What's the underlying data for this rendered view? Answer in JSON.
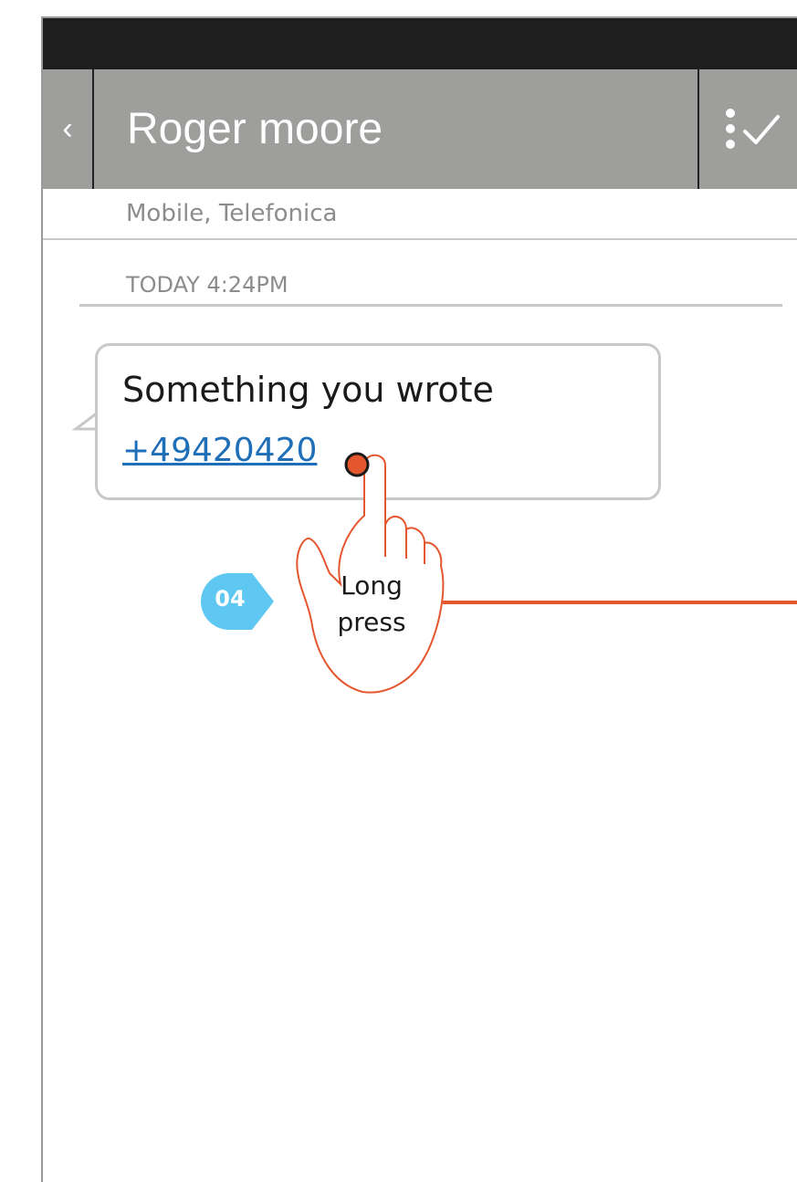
{
  "header": {
    "back_glyph": "‹",
    "title": "Roger moore",
    "actions_icon": "more-select-icon"
  },
  "contact": {
    "subtitle": "Mobile, Telefonica"
  },
  "conversation": {
    "timestamp": "TODAY 4:24PM",
    "message": {
      "text": "Something you wrote",
      "link": "+49420420"
    }
  },
  "annotation": {
    "step": "04",
    "gesture_line1": "Long",
    "gesture_line2": "press",
    "accent_color": "#e4572e",
    "badge_color": "#5ec8f2"
  }
}
